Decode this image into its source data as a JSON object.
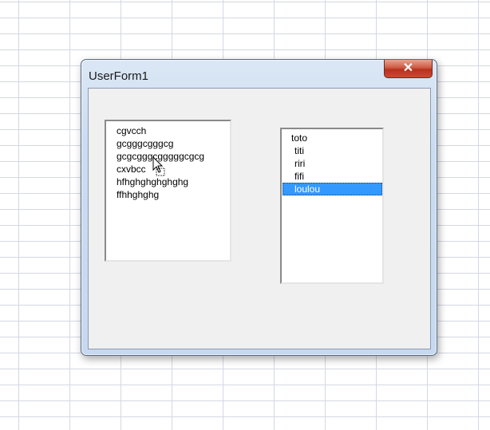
{
  "window": {
    "title": "UserForm1",
    "close_label": "✕"
  },
  "listbox1": {
    "items": [
      "cgvcch",
      "gcgggcgggcg",
      "gcgcgggcgggggcgcg",
      "cxvbcc",
      "hfhghghghghghg",
      "ffhhghghg"
    ]
  },
  "listbox2": {
    "items": [
      "toto",
      "titi",
      "riri",
      "fifi",
      "loulou"
    ],
    "selected": "loulou"
  },
  "colors": {
    "selection": "#3399ff",
    "form_background": "#f0f0f0",
    "close_button": "#c84b34"
  }
}
